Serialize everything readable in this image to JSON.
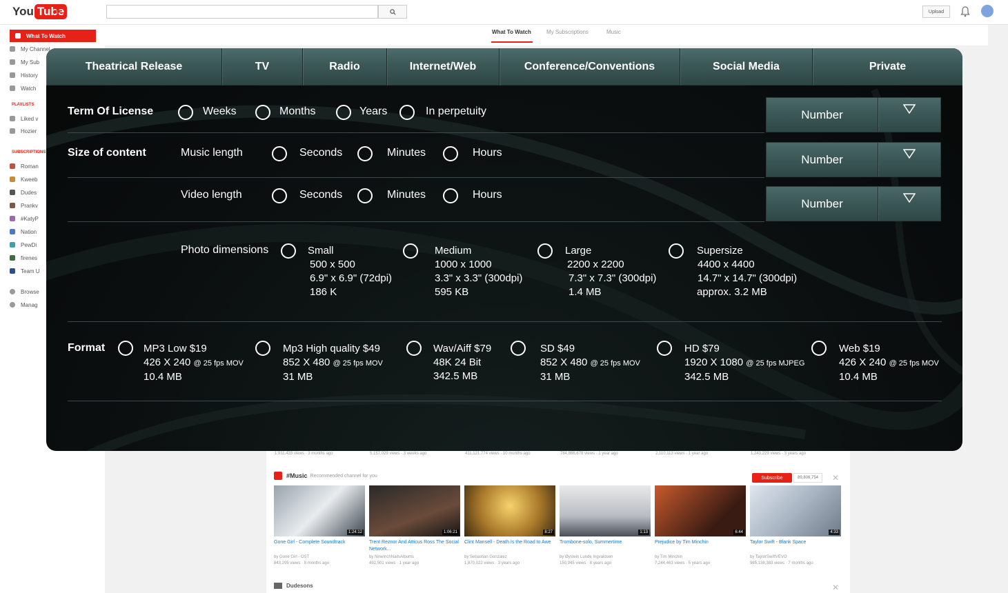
{
  "youtube": {
    "logo_you": "You",
    "logo_tube": "Tube",
    "upload_label": "Upload",
    "tabs": [
      {
        "label": "What To Watch"
      },
      {
        "label": "My Subscriptions"
      },
      {
        "label": "Music"
      }
    ],
    "sidebar": {
      "items": [
        {
          "label": "What To Watch"
        },
        {
          "label": "My Channel"
        },
        {
          "label": "My Sub"
        },
        {
          "label": "History"
        },
        {
          "label": "Watch"
        }
      ],
      "playlists_header": "PLAYLISTS",
      "playlists": [
        {
          "label": "Liked v"
        },
        {
          "label": "Hozier"
        }
      ],
      "subscriptions_header": "SUBSCRIPTIONS",
      "subscriptions": [
        {
          "label": "Roman"
        },
        {
          "label": "Kweeb"
        },
        {
          "label": "Dudes"
        },
        {
          "label": "Prankv"
        },
        {
          "label": "#KatyP"
        },
        {
          "label": "Nation"
        },
        {
          "label": "PewDi"
        },
        {
          "label": "firenes"
        },
        {
          "label": "Team U"
        }
      ],
      "footer": [
        {
          "label": "Browse"
        },
        {
          "label": "Manag"
        }
      ]
    },
    "stats_row": [
      "1,911,433 views · 3 months ago",
      "5,157,029 views · 3 weeks ago",
      "411,121,774 views · 10 months ago",
      "784,866,678 views · 1 year ago",
      "2,110,113 views · 1 year ago",
      "1,243,229 views · 3 years ago"
    ],
    "music_shelf": {
      "title": "#Music",
      "subtitle": "Recommended channel for you",
      "subscribe_label": "Subscribe",
      "subscriber_count": "89,806,754",
      "videos": [
        {
          "title": "Gone Girl - Complete Soundtrack",
          "meta1": "by Gone Girl - OST",
          "meta2": "843,295 views · 8 months ago",
          "duration": "1:24:12"
        },
        {
          "title": "Trent Reznor And Atticus Ross The Social Network...",
          "meta1": "by NineInchNailsAlbums",
          "meta2": "492,501 views · 1 year ago",
          "duration": "1:06:21"
        },
        {
          "title": "Clint Mansell - Death Is the Road to Awe",
          "meta1": "by Sebastian Gonzalez",
          "meta2": "1,870,022 views · 3 years ago",
          "duration": "8:27"
        },
        {
          "title": "Trombone-solo, Summertime",
          "meta1": "by Øystein Lunde Ingvaldsen",
          "meta2": "150,945 views · 8 years ago",
          "duration": "1:13"
        },
        {
          "title": "Prejudice by Tim Minchin",
          "meta1": "by Tim Minchin",
          "meta2": "7,244,463 views · 5 years ago",
          "duration": "6:44"
        },
        {
          "title": "Taylor Swift - Blank Space",
          "meta1": "by TaylorSwiftVEVO",
          "meta2": "965,138,383 views · 7 months ago",
          "duration": "4:33"
        }
      ]
    },
    "next_shelf_title": "Dudesons"
  },
  "panel": {
    "tabs": [
      {
        "label": "Theatrical Release"
      },
      {
        "label": "TV"
      },
      {
        "label": "Radio"
      },
      {
        "label": "Internet/Web"
      },
      {
        "label": "Conference/Conventions"
      },
      {
        "label": "Social Media"
      },
      {
        "label": "Private"
      }
    ],
    "term": {
      "label": "Term Of License",
      "options": [
        "Weeks",
        "Months",
        "Years",
        "In perpetuity"
      ],
      "select_label": "Number"
    },
    "size": {
      "label": "Size of content",
      "music_label": "Music length",
      "music_options": [
        "Seconds",
        "Minutes",
        "Hours"
      ],
      "music_select": "Number",
      "video_label": "Video length",
      "video_options": [
        "Seconds",
        "Minutes",
        "Hours"
      ],
      "video_select": "Number"
    },
    "photo": {
      "label": "Photo dimensions",
      "options": [
        {
          "name": "Small",
          "line1": "500 x 500",
          "line2": "6.9\" x 6.9\" (72dpi)",
          "line3": "186 K"
        },
        {
          "name": "Medium",
          "line1": "1000 x 1000",
          "line2": "3.3\" x 3.3\" (300dpi)",
          "line3": "595 KB"
        },
        {
          "name": "Large",
          "line1": "2200 x 2200",
          "line2": "7.3\" x 7.3\" (300dpi)",
          "line3": "1.4 MB"
        },
        {
          "name": "Supersize",
          "line1": "4400 x 4400",
          "line2": "14.7\" x 14.7\" (300dpi)",
          "line3": "approx. 3.2 MB"
        }
      ]
    },
    "format": {
      "label": "Format",
      "options": [
        {
          "name": "MP3 Low $19",
          "res": "426 X 240",
          "extra": "@ 25 fps MOV",
          "size": "10.4 MB"
        },
        {
          "name": "Mp3 High quality $49",
          "res": "852 X 480",
          "extra": "@ 25 fps MOV",
          "size": "31 MB"
        },
        {
          "name": "Wav/Aiff $79",
          "res": "48K 24 Bit",
          "extra": "",
          "size": "342.5 MB"
        },
        {
          "name": "SD $49",
          "res": "852 X 480",
          "extra": "@ 25 fps MOV",
          "size": "31 MB"
        },
        {
          "name": "HD $79",
          "res": "1920 X 1080",
          "extra": "@ 25 fps MJPEG",
          "size": "342.5 MB"
        },
        {
          "name": "Web $19",
          "res": "426 X 240",
          "extra": "@ 25 fps MOV",
          "size": "10.4 MB"
        }
      ]
    },
    "colors": {
      "tab_bg": "#3b5857",
      "panel_bg": "#0b0f0f",
      "text": "#ffffff",
      "youtube_red": "#e62117"
    }
  }
}
